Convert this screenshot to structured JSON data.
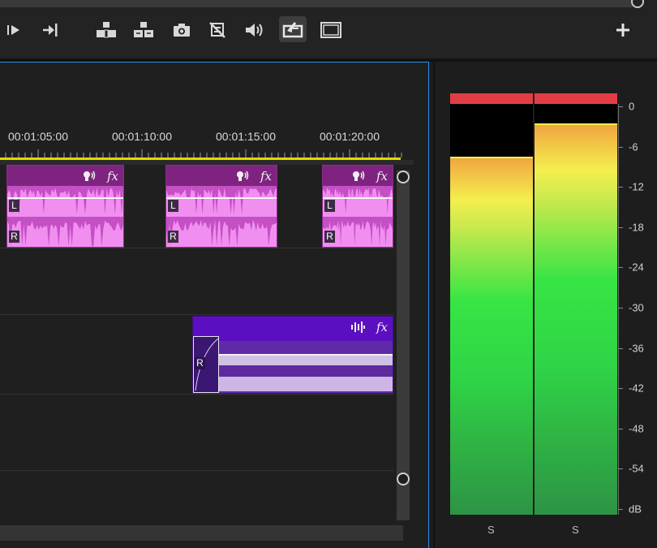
{
  "toolbar": {
    "buttons": [
      {
        "name": "step-forward-button",
        "icon": "play-step-icon"
      },
      {
        "name": "go-to-out-button",
        "icon": "go-to-out-icon"
      },
      {
        "name": "lift-button",
        "icon": "lift-icon"
      },
      {
        "name": "extract-button",
        "icon": "extract-icon"
      },
      {
        "name": "export-frame-button",
        "icon": "camera-icon"
      },
      {
        "name": "comparison-view-button",
        "icon": "comparison-icon"
      },
      {
        "name": "audio-button",
        "icon": "speaker-icon"
      },
      {
        "name": "export-button",
        "icon": "export-icon",
        "active": true
      },
      {
        "name": "safe-margins-button",
        "icon": "monitor-icon"
      },
      {
        "name": "add-button",
        "icon": "plus-icon"
      }
    ]
  },
  "timeline": {
    "timecodes": [
      "00:01:05:00",
      "00:01:10:00",
      "00:01:15:00",
      "00:01:20:00"
    ],
    "channel_left": "L",
    "channel_right": "R",
    "fx_label": "fx",
    "track_a_clips": [
      {
        "name": "audio-clip-1"
      },
      {
        "name": "audio-clip-2"
      },
      {
        "name": "audio-clip-3"
      }
    ],
    "track_b_clip": {
      "name": "audio-clip-4"
    }
  },
  "meter": {
    "db_scale": [
      "0",
      "-6",
      "-12",
      "-18",
      "-24",
      "-30",
      "-36",
      "-42",
      "-48",
      "-54",
      "dB"
    ],
    "channels": [
      {
        "label": "S",
        "level_db": -7.5
      },
      {
        "label": "S",
        "level_db": -2.5
      }
    ],
    "colors": {
      "peak": "#e23d45",
      "clip_pink": "#c54fc5",
      "clip_purple": "#5b0fc0",
      "focus": "#2d8ceb"
    }
  }
}
